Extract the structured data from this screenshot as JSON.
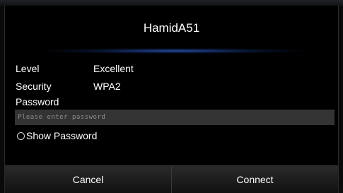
{
  "dialog": {
    "title": "HamidA51",
    "level_label": "Level",
    "level_value": "Excellent",
    "security_label": "Security",
    "security_value": "WPA2",
    "password_label": "Password",
    "password_placeholder": "Please enter password",
    "password_value": "",
    "show_password_label": "Show Password",
    "show_password_checked": false,
    "cancel_label": "Cancel",
    "connect_label": "Connect"
  }
}
